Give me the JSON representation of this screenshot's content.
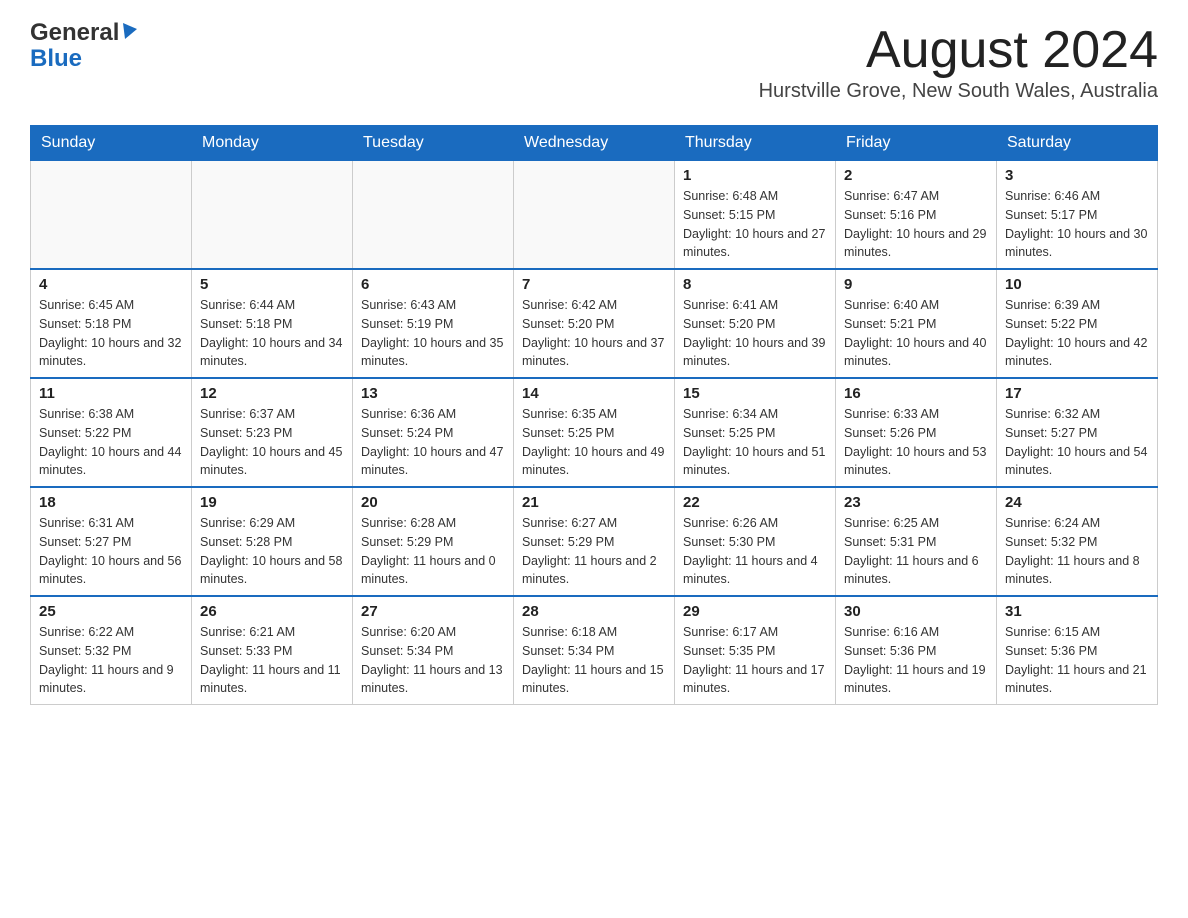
{
  "header": {
    "logo_general": "General",
    "logo_blue": "Blue",
    "month_title": "August 2024",
    "location": "Hurstville Grove, New South Wales, Australia"
  },
  "calendar": {
    "days_of_week": [
      "Sunday",
      "Monday",
      "Tuesday",
      "Wednesday",
      "Thursday",
      "Friday",
      "Saturday"
    ],
    "weeks": [
      [
        {
          "day": "",
          "info": ""
        },
        {
          "day": "",
          "info": ""
        },
        {
          "day": "",
          "info": ""
        },
        {
          "day": "",
          "info": ""
        },
        {
          "day": "1",
          "info": "Sunrise: 6:48 AM\nSunset: 5:15 PM\nDaylight: 10 hours and 27 minutes."
        },
        {
          "day": "2",
          "info": "Sunrise: 6:47 AM\nSunset: 5:16 PM\nDaylight: 10 hours and 29 minutes."
        },
        {
          "day": "3",
          "info": "Sunrise: 6:46 AM\nSunset: 5:17 PM\nDaylight: 10 hours and 30 minutes."
        }
      ],
      [
        {
          "day": "4",
          "info": "Sunrise: 6:45 AM\nSunset: 5:18 PM\nDaylight: 10 hours and 32 minutes."
        },
        {
          "day": "5",
          "info": "Sunrise: 6:44 AM\nSunset: 5:18 PM\nDaylight: 10 hours and 34 minutes."
        },
        {
          "day": "6",
          "info": "Sunrise: 6:43 AM\nSunset: 5:19 PM\nDaylight: 10 hours and 35 minutes."
        },
        {
          "day": "7",
          "info": "Sunrise: 6:42 AM\nSunset: 5:20 PM\nDaylight: 10 hours and 37 minutes."
        },
        {
          "day": "8",
          "info": "Sunrise: 6:41 AM\nSunset: 5:20 PM\nDaylight: 10 hours and 39 minutes."
        },
        {
          "day": "9",
          "info": "Sunrise: 6:40 AM\nSunset: 5:21 PM\nDaylight: 10 hours and 40 minutes."
        },
        {
          "day": "10",
          "info": "Sunrise: 6:39 AM\nSunset: 5:22 PM\nDaylight: 10 hours and 42 minutes."
        }
      ],
      [
        {
          "day": "11",
          "info": "Sunrise: 6:38 AM\nSunset: 5:22 PM\nDaylight: 10 hours and 44 minutes."
        },
        {
          "day": "12",
          "info": "Sunrise: 6:37 AM\nSunset: 5:23 PM\nDaylight: 10 hours and 45 minutes."
        },
        {
          "day": "13",
          "info": "Sunrise: 6:36 AM\nSunset: 5:24 PM\nDaylight: 10 hours and 47 minutes."
        },
        {
          "day": "14",
          "info": "Sunrise: 6:35 AM\nSunset: 5:25 PM\nDaylight: 10 hours and 49 minutes."
        },
        {
          "day": "15",
          "info": "Sunrise: 6:34 AM\nSunset: 5:25 PM\nDaylight: 10 hours and 51 minutes."
        },
        {
          "day": "16",
          "info": "Sunrise: 6:33 AM\nSunset: 5:26 PM\nDaylight: 10 hours and 53 minutes."
        },
        {
          "day": "17",
          "info": "Sunrise: 6:32 AM\nSunset: 5:27 PM\nDaylight: 10 hours and 54 minutes."
        }
      ],
      [
        {
          "day": "18",
          "info": "Sunrise: 6:31 AM\nSunset: 5:27 PM\nDaylight: 10 hours and 56 minutes."
        },
        {
          "day": "19",
          "info": "Sunrise: 6:29 AM\nSunset: 5:28 PM\nDaylight: 10 hours and 58 minutes."
        },
        {
          "day": "20",
          "info": "Sunrise: 6:28 AM\nSunset: 5:29 PM\nDaylight: 11 hours and 0 minutes."
        },
        {
          "day": "21",
          "info": "Sunrise: 6:27 AM\nSunset: 5:29 PM\nDaylight: 11 hours and 2 minutes."
        },
        {
          "day": "22",
          "info": "Sunrise: 6:26 AM\nSunset: 5:30 PM\nDaylight: 11 hours and 4 minutes."
        },
        {
          "day": "23",
          "info": "Sunrise: 6:25 AM\nSunset: 5:31 PM\nDaylight: 11 hours and 6 minutes."
        },
        {
          "day": "24",
          "info": "Sunrise: 6:24 AM\nSunset: 5:32 PM\nDaylight: 11 hours and 8 minutes."
        }
      ],
      [
        {
          "day": "25",
          "info": "Sunrise: 6:22 AM\nSunset: 5:32 PM\nDaylight: 11 hours and 9 minutes."
        },
        {
          "day": "26",
          "info": "Sunrise: 6:21 AM\nSunset: 5:33 PM\nDaylight: 11 hours and 11 minutes."
        },
        {
          "day": "27",
          "info": "Sunrise: 6:20 AM\nSunset: 5:34 PM\nDaylight: 11 hours and 13 minutes."
        },
        {
          "day": "28",
          "info": "Sunrise: 6:18 AM\nSunset: 5:34 PM\nDaylight: 11 hours and 15 minutes."
        },
        {
          "day": "29",
          "info": "Sunrise: 6:17 AM\nSunset: 5:35 PM\nDaylight: 11 hours and 17 minutes."
        },
        {
          "day": "30",
          "info": "Sunrise: 6:16 AM\nSunset: 5:36 PM\nDaylight: 11 hours and 19 minutes."
        },
        {
          "day": "31",
          "info": "Sunrise: 6:15 AM\nSunset: 5:36 PM\nDaylight: 11 hours and 21 minutes."
        }
      ]
    ]
  }
}
